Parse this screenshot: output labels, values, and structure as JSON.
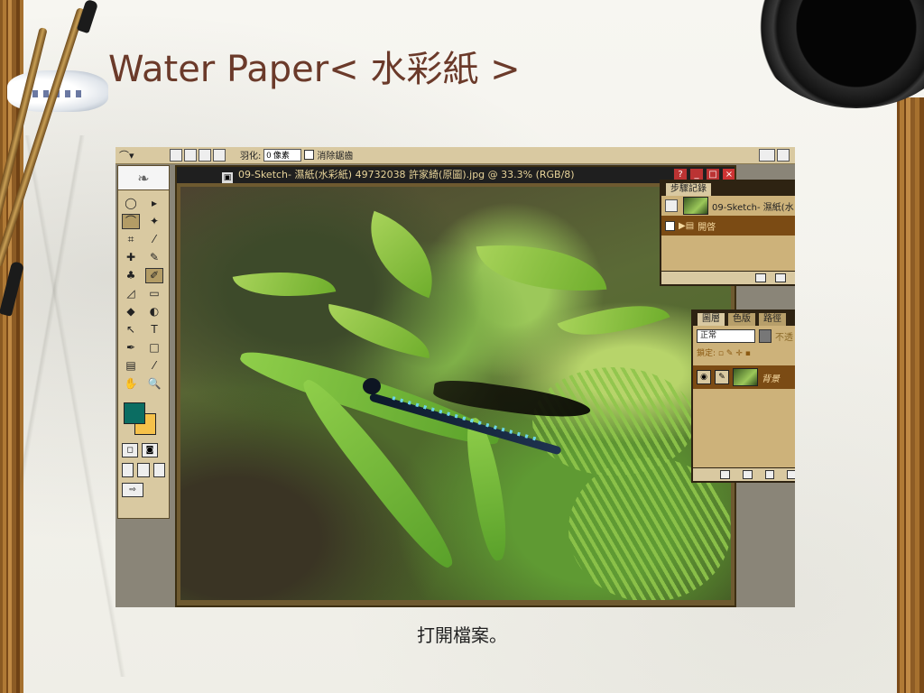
{
  "slide": {
    "title": "Water Paper< 水彩紙 >",
    "caption": "打開檔案。"
  },
  "options_bar": {
    "feather_label": "羽化:",
    "feather_value": "0 像素",
    "anti_alias_label": "消除鋸齒"
  },
  "toolbox": {
    "header_icon": "feather-icon",
    "tools": [
      {
        "glyph": "◯",
        "name": "marquee-tool-icon"
      },
      {
        "glyph": "▸",
        "name": "move-tool-icon"
      },
      {
        "glyph": "⌒",
        "name": "lasso-tool-icon",
        "selected": true
      },
      {
        "glyph": "✦",
        "name": "magic-wand-icon"
      },
      {
        "glyph": "⌗",
        "name": "crop-tool-icon"
      },
      {
        "glyph": "⁄",
        "name": "slice-tool-icon"
      },
      {
        "glyph": "✚",
        "name": "healing-brush-icon"
      },
      {
        "glyph": "✎",
        "name": "brush-tool-icon"
      },
      {
        "glyph": "♣",
        "name": "clone-stamp-icon"
      },
      {
        "glyph": "✐",
        "name": "history-brush-icon",
        "selected": true
      },
      {
        "glyph": "◿",
        "name": "eraser-tool-icon"
      },
      {
        "glyph": "▭",
        "name": "gradient-tool-icon"
      },
      {
        "glyph": "◆",
        "name": "blur-tool-icon"
      },
      {
        "glyph": "◐",
        "name": "dodge-tool-icon"
      },
      {
        "glyph": "↖",
        "name": "path-select-icon"
      },
      {
        "glyph": "T",
        "name": "type-tool-icon"
      },
      {
        "glyph": "✒",
        "name": "pen-tool-icon"
      },
      {
        "glyph": "□",
        "name": "shape-tool-icon"
      },
      {
        "glyph": "▤",
        "name": "notes-tool-icon"
      },
      {
        "glyph": "⁄",
        "name": "eyedropper-icon"
      },
      {
        "glyph": "✋",
        "name": "hand-tool-icon"
      },
      {
        "glyph": "🔍",
        "name": "zoom-tool-icon"
      }
    ],
    "foreground_color": "#0b6d62",
    "background_color": "#f5c14a"
  },
  "document": {
    "title": "09-Sketch- 濕紙(水彩紙) 49732038 許家綺(原圖).jpg @ 33.3% (RGB/8)"
  },
  "history_panel": {
    "tabs": [
      "步驟記錄"
    ],
    "snapshot_label": "09-Sketch- 濕紙(水",
    "steps": [
      "開啓"
    ]
  },
  "layers_panel": {
    "tabs": [
      "圖層",
      "色版",
      "路徑"
    ],
    "blend_mode": "正常",
    "opacity_label": "不透",
    "lock_label": "鎖定:",
    "layer_name": "背景"
  }
}
